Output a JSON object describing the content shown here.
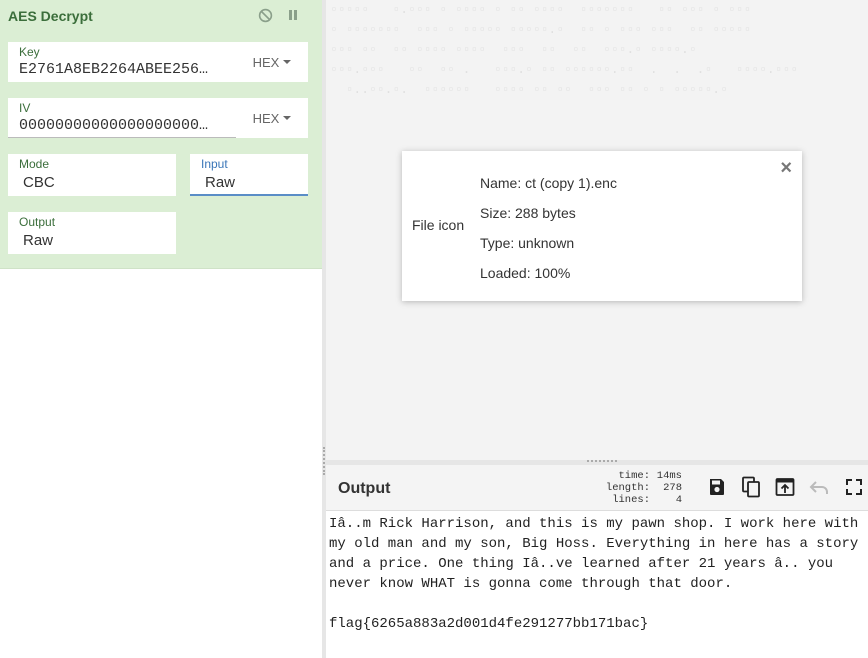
{
  "operation": {
    "title": "AES Decrypt",
    "key": {
      "label": "Key",
      "value": "E2761A8EB2264ABEE256…",
      "format": "HEX"
    },
    "iv": {
      "label": "IV",
      "value": "00000000000000000000…",
      "format": "HEX"
    },
    "mode": {
      "label": "Mode",
      "value": "CBC"
    },
    "input": {
      "label": "Input",
      "value": "Raw"
    },
    "output": {
      "label": "Output",
      "value": "Raw"
    },
    "icons": {
      "disable": "disable-icon",
      "breakpoint": "pause-icon"
    }
  },
  "file_info": {
    "icon_label": "File icon",
    "name": "Name: ct (copy 1).enc",
    "size": "Size: 288 bytes",
    "type": "Type: unknown",
    "loaded": "Loaded: 100%",
    "close": "×"
  },
  "output_panel": {
    "title": "Output",
    "stats": [
      {
        "key": "time:",
        "value": "14ms"
      },
      {
        "key": "length:",
        "value": "278"
      },
      {
        "key": "lines:",
        "value": "4"
      }
    ],
    "text": "Iâ..m Rick Harrison, and this is my pawn shop. I work here with my old man and my son, Big Hoss. Everything in here has a story and a price. One thing Iâ..ve learned after 21 years â.. you never know WHAT is gonna come through that door.\n\nflag{6265a883a2d001d4fe291277bb171bac}"
  },
  "colors": {
    "operation_bg": "#dbeed4",
    "accent_green": "#3b6e3b",
    "focus_blue": "#5a8dc7"
  }
}
